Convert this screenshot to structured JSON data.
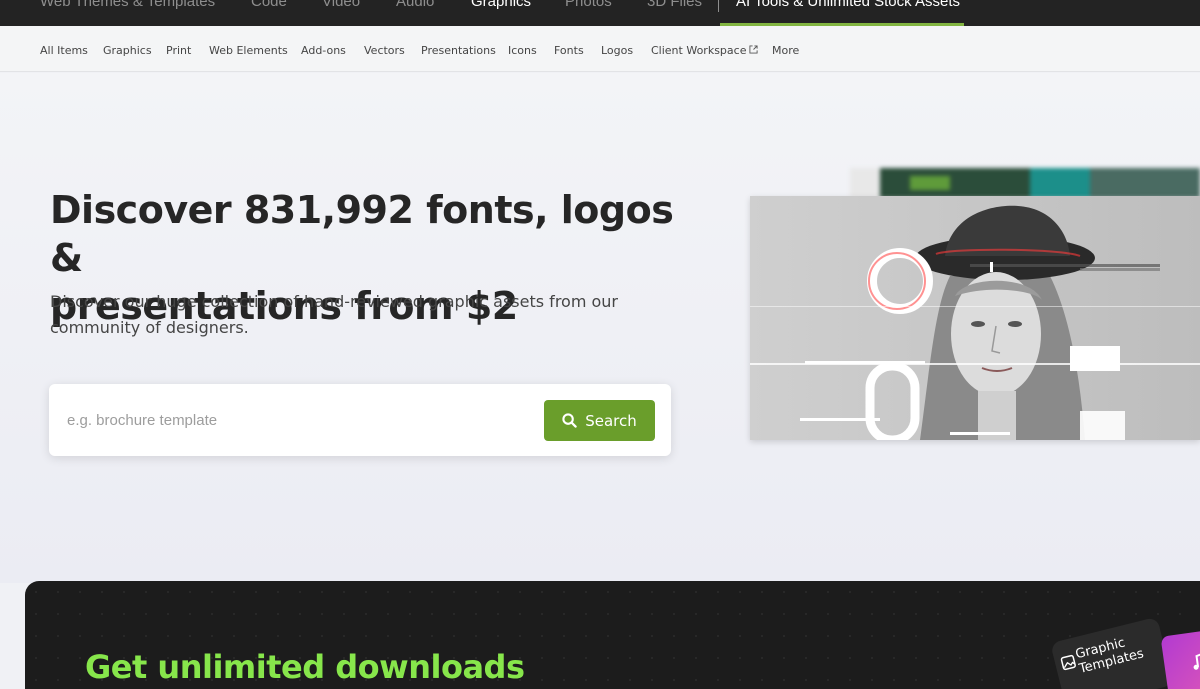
{
  "topnav": {
    "items": [
      {
        "label": "Web Themes & Templates"
      },
      {
        "label": "Code"
      },
      {
        "label": "Video"
      },
      {
        "label": "Audio"
      },
      {
        "label": "Graphics"
      },
      {
        "label": "Photos"
      },
      {
        "label": "3D Files"
      },
      {
        "label": "AI Tools & Unlimited Stock Assets"
      }
    ],
    "active": "Graphics",
    "accent_color": "#82b541"
  },
  "subnav": {
    "items": [
      {
        "label": "All Items"
      },
      {
        "label": "Graphics"
      },
      {
        "label": "Print"
      },
      {
        "label": "Web Elements"
      },
      {
        "label": "Add-ons"
      },
      {
        "label": "Vectors"
      },
      {
        "label": "Presentations"
      },
      {
        "label": "Icons"
      },
      {
        "label": "Fonts"
      },
      {
        "label": "Logos"
      },
      {
        "label": "Client Workspace"
      },
      {
        "label": "More"
      }
    ]
  },
  "hero": {
    "title_line1": "Discover 831,992 fonts, logos &",
    "title_line2": "presentations from $2",
    "subtitle_line1": "Discover our huge collection of hand-reviewed graphic assets from our",
    "subtitle_line2": "community of designers.",
    "search": {
      "placeholder": "e.g. brochure template",
      "value": "",
      "button_label": "Search",
      "button_color": "#6a9e2b"
    }
  },
  "promo": {
    "title": "Get unlimited downloads",
    "card_label_line1": "Graphic",
    "card_label_line2": "Templates",
    "title_color": "#87e64b"
  }
}
